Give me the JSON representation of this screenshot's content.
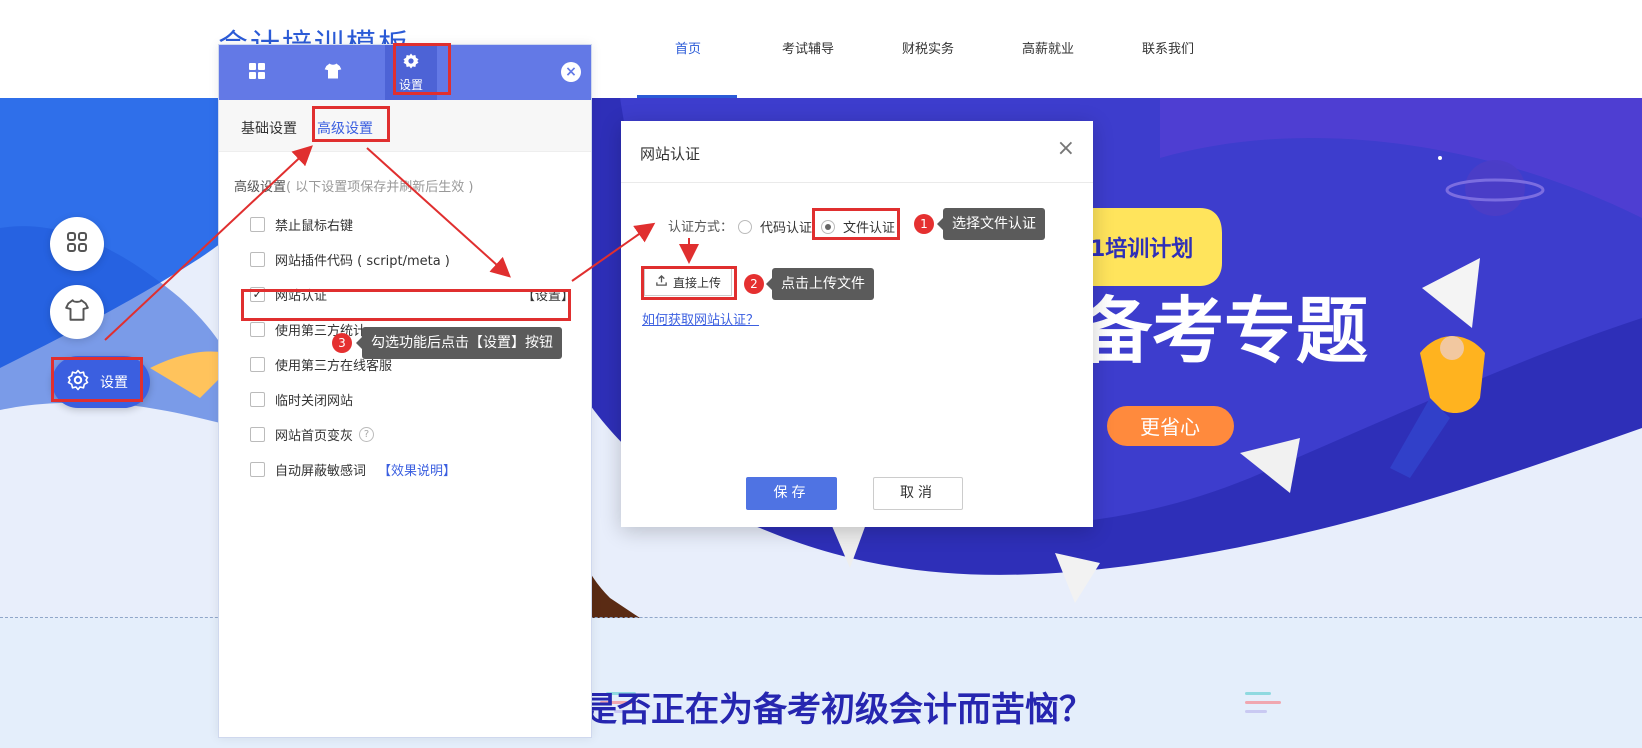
{
  "site": {
    "logo": "会计培训模板",
    "nav": [
      {
        "label": "首页",
        "active": true
      },
      {
        "label": "考试辅导",
        "active": false
      },
      {
        "label": "财税实务",
        "active": false
      },
      {
        "label": "高薪就业",
        "active": false
      },
      {
        "label": "联系我们",
        "active": false
      }
    ],
    "banner": {
      "plan_text": "1培训计划",
      "headline": "备考专题",
      "pill": "更省心"
    },
    "section_title": "你是否正在为备考初级会计而苦恼？"
  },
  "dock": {
    "settings_label": "设置",
    "icons": [
      "apps-icon",
      "tshirt-icon",
      "gear-icon"
    ]
  },
  "panel": {
    "tabs": [
      {
        "icon": "apps-icon",
        "label": ""
      },
      {
        "icon": "tshirt-icon",
        "label": ""
      },
      {
        "icon": "gear-icon",
        "label": "设置",
        "active": true
      }
    ],
    "close": "×",
    "subtabs": [
      {
        "label": "基础设置",
        "active": false
      },
      {
        "label": "高级设置",
        "active": true
      }
    ],
    "heading": "高级设置",
    "heading_note": "( 以下设置项保存并刷新后生效 )",
    "options": [
      {
        "label": "禁止鼠标右键",
        "checked": false
      },
      {
        "label": "网站插件代码 ( script/meta )",
        "checked": false
      },
      {
        "label": "网站认证",
        "checked": true,
        "action": "【设置】"
      },
      {
        "label": "使用第三方统计",
        "checked": false
      },
      {
        "label": "使用第三方在线客服",
        "checked": false
      },
      {
        "label": "临时关闭网站",
        "checked": false
      },
      {
        "label": "网站首页变灰",
        "checked": false,
        "help": "?"
      },
      {
        "label": "自动屏蔽敏感词",
        "checked": false,
        "link": "【效果说明】"
      }
    ]
  },
  "modal": {
    "title": "网站认证",
    "close": "×",
    "auth_label": "认证方式：",
    "methods": [
      {
        "label": "代码认证",
        "selected": false
      },
      {
        "label": "文件认证",
        "selected": true
      }
    ],
    "upload_label": "直接上传",
    "help_link": "如何获取网站认证？",
    "save": "保存",
    "cancel": "取消"
  },
  "annotations": {
    "step1": {
      "num": "1",
      "text": "选择文件认证"
    },
    "step2": {
      "num": "2",
      "text": "点击上传文件"
    },
    "step3": {
      "num": "3",
      "text": "勾选功能后点击【设置】按钮"
    }
  },
  "colors": {
    "brand": "#3b5fe0",
    "panel_header": "#6379e6",
    "highlight": "#e02f2f",
    "tooltip": "#5b5b5b"
  }
}
